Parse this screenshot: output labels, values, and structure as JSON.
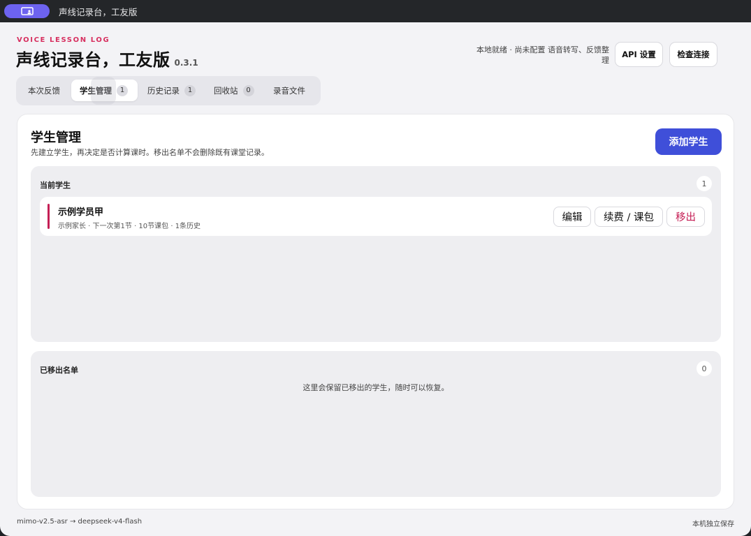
{
  "titlebar": {
    "app_icon": "monitor-user-icon",
    "title": "声线记录台，工友版"
  },
  "header": {
    "eyebrow": "VOICE LESSON LOG",
    "title": "声线记录台，工友版",
    "version": "0.3.1",
    "status": "本地就绪 · 尚未配置 语音转写、反馈整理",
    "api_button": "API 设置",
    "check_button": "检查连接"
  },
  "tabs": [
    {
      "label": "本次反馈",
      "count": null,
      "active": false
    },
    {
      "label": "学生管理",
      "count": "1",
      "active": true
    },
    {
      "label": "历史记录",
      "count": "1",
      "active": false
    },
    {
      "label": "回收站",
      "count": "0",
      "active": false
    },
    {
      "label": "录音文件",
      "count": null,
      "active": false
    }
  ],
  "main": {
    "title": "学生管理",
    "subtitle": "先建立学生，再决定是否计算课时。移出名单不会删除既有课堂记录。",
    "add_button": "添加学生",
    "current": {
      "label": "当前学生",
      "count": "1",
      "students": [
        {
          "name": "示例学员甲",
          "meta": "示例家长 · 下一次第1节 · 10节课包 · 1条历史",
          "edit_label": "编辑",
          "renew_label": "续费 / 课包",
          "remove_label": "移出"
        }
      ]
    },
    "removed": {
      "label": "已移出名单",
      "count": "0",
      "empty_text": "这里会保留已移出的学生，随时可以恢复。"
    }
  },
  "footer": {
    "models": "mimo-v2.5-asr → deepseek-v4-flash",
    "storage": "本机独立保存"
  },
  "colors": {
    "accent": "#3f4fd9",
    "eyebrow": "#d72f5f",
    "student_bar": "#c51f55",
    "app_pill": "#6d63f0"
  }
}
